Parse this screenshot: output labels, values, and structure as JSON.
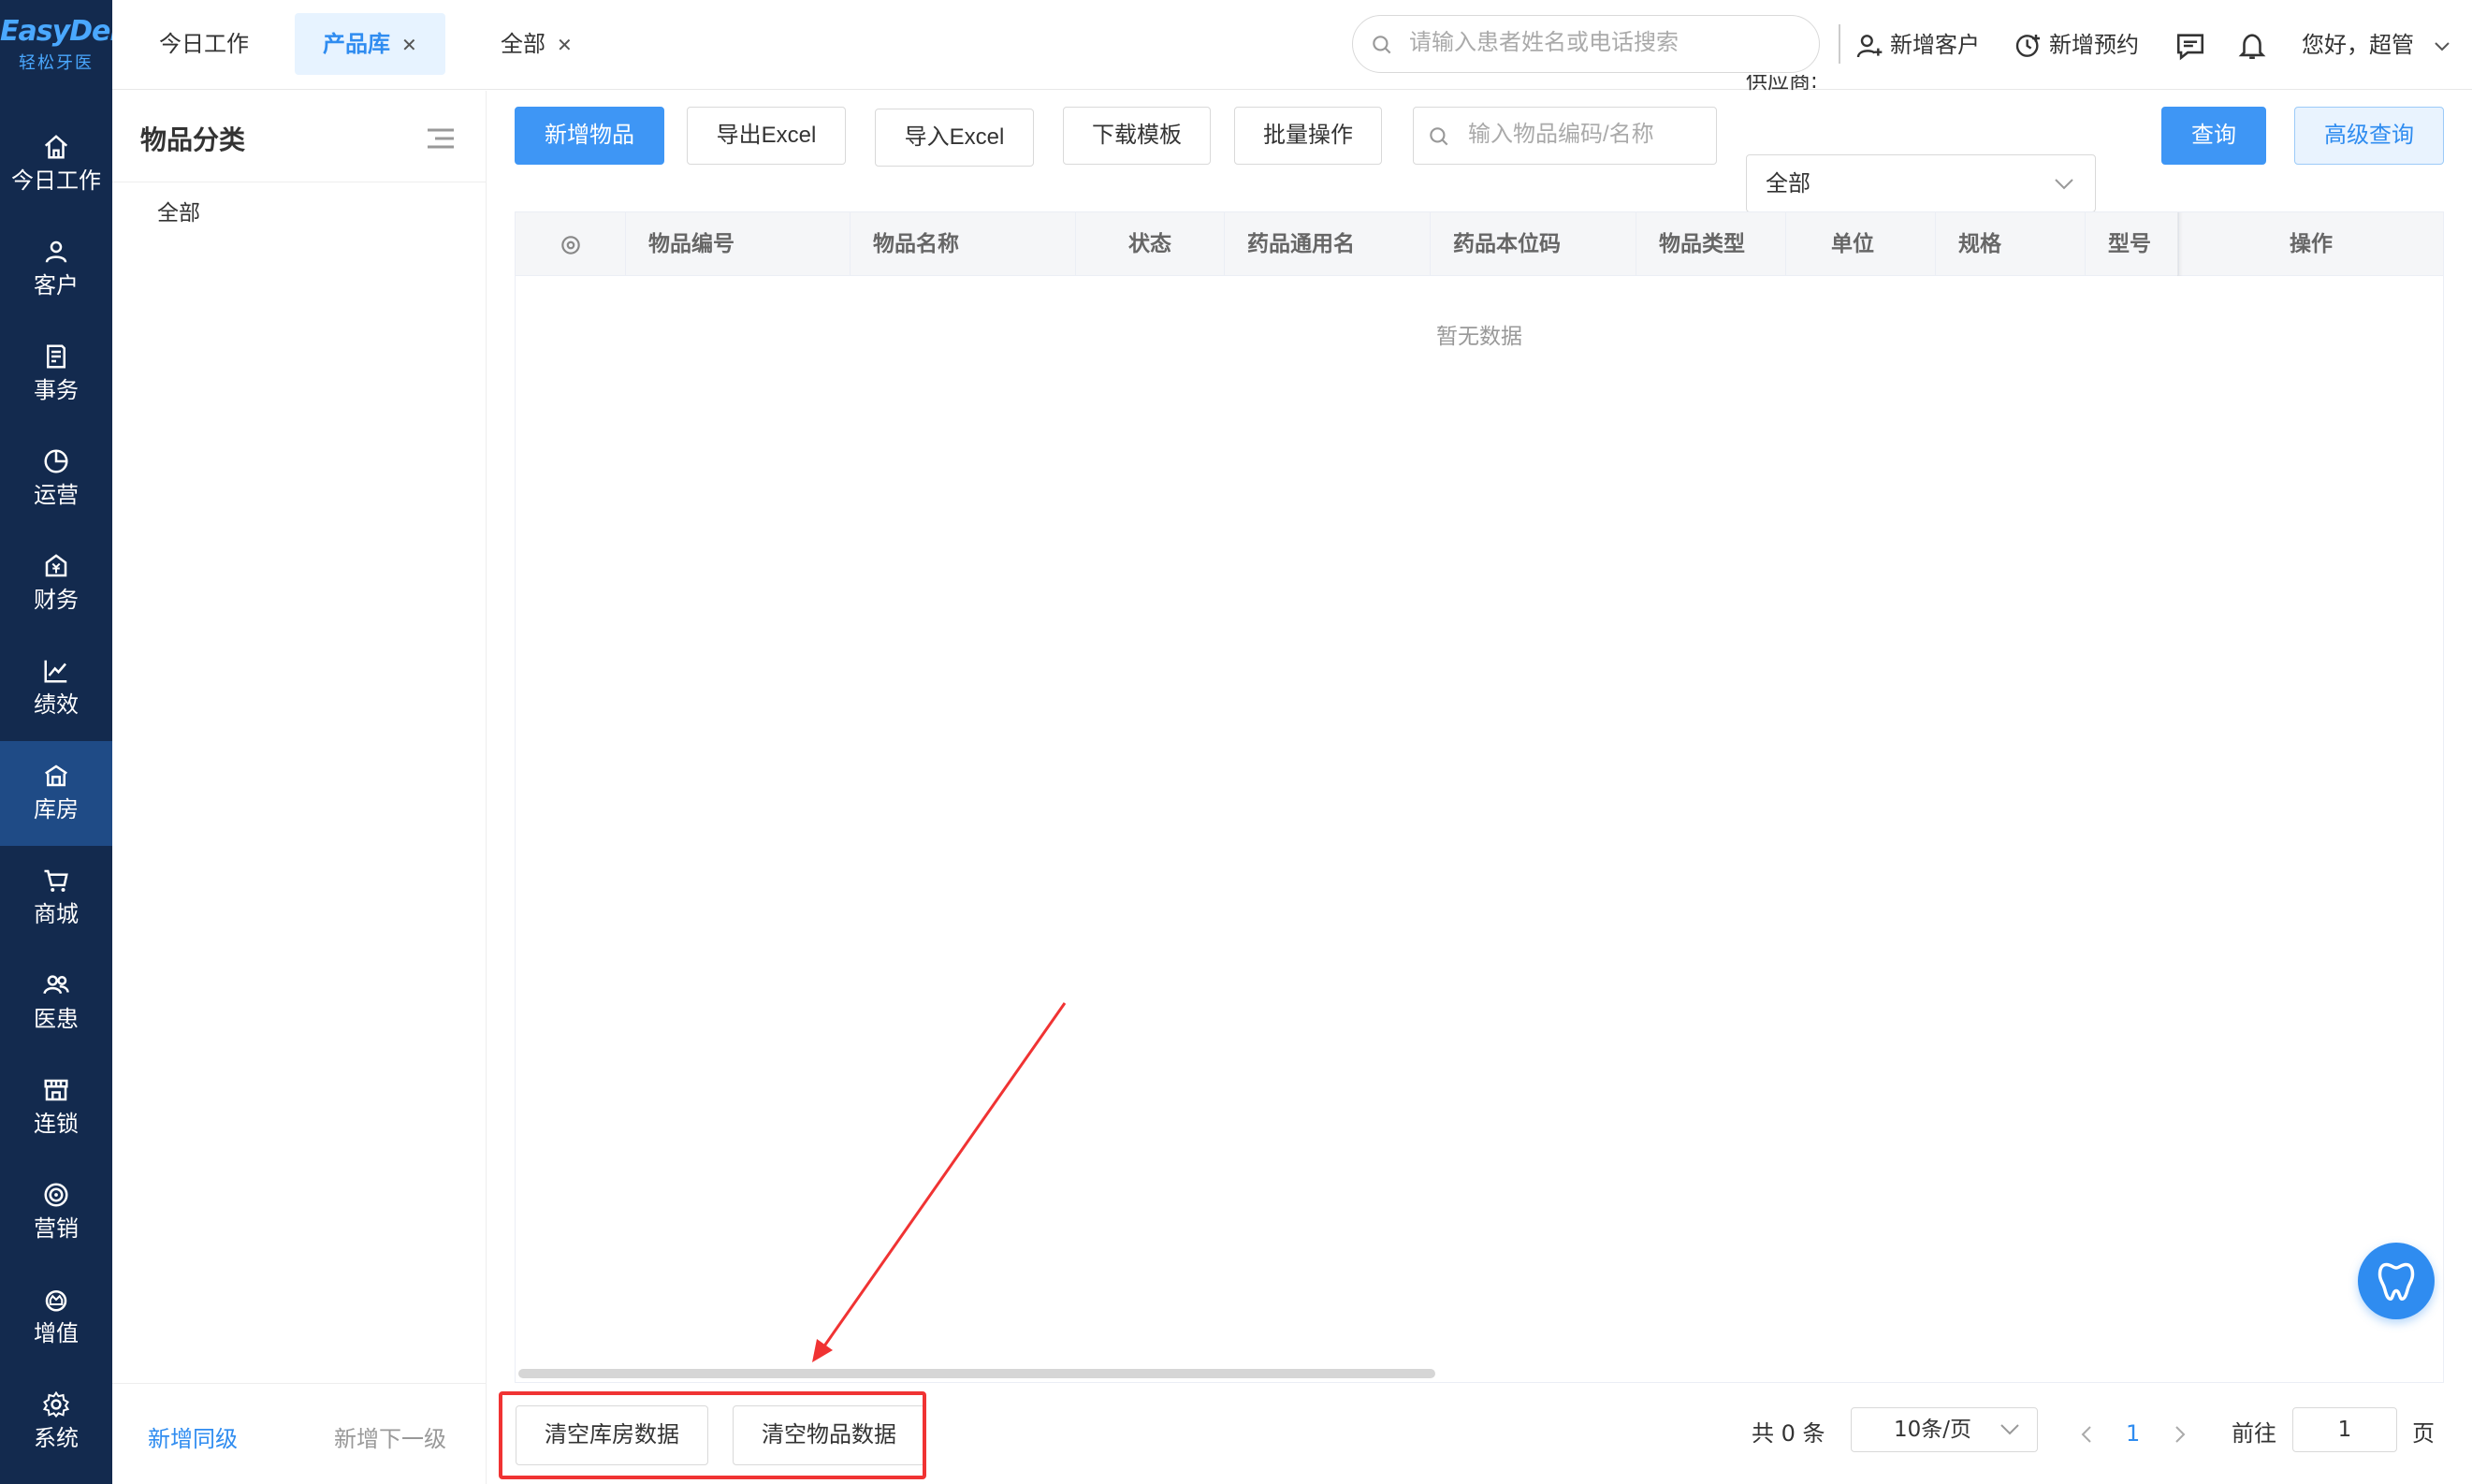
{
  "brand": {
    "logo_en": "EasyDent",
    "logo_cn": "轻松牙医",
    "accent": "#2f8cf0",
    "nav_bg": "#132a4e"
  },
  "nav": [
    {
      "label": "今日工作",
      "icon": "home-icon"
    },
    {
      "label": "客户",
      "icon": "user-icon"
    },
    {
      "label": "事务",
      "icon": "document-icon"
    },
    {
      "label": "运营",
      "icon": "pie-chart-icon"
    },
    {
      "label": "财务",
      "icon": "money-icon"
    },
    {
      "label": "绩效",
      "icon": "line-chart-icon"
    },
    {
      "label": "库房",
      "icon": "warehouse-icon",
      "active": true
    },
    {
      "label": "商城",
      "icon": "cart-icon"
    },
    {
      "label": "医患",
      "icon": "people-icon"
    },
    {
      "label": "连锁",
      "icon": "store-icon"
    },
    {
      "label": "营销",
      "icon": "target-icon"
    },
    {
      "label": "增值",
      "icon": "crown-icon"
    },
    {
      "label": "系统",
      "icon": "gear-icon"
    }
  ],
  "tabs": [
    {
      "label": "今日工作",
      "closable": false
    },
    {
      "label": "产品库",
      "closable": true,
      "active": true
    },
    {
      "label": "全部",
      "closable": true
    }
  ],
  "topbar": {
    "search_placeholder": "请输入患者姓名或电话搜索",
    "new_customer": "新增客户",
    "new_appointment": "新增预约",
    "greeting": "您好，超管"
  },
  "category": {
    "title": "物品分类",
    "items": [
      "全部"
    ],
    "add_sibling": "新增同级",
    "add_child": "新增下一级"
  },
  "toolbar": {
    "add_item": "新增物品",
    "export_excel": "导出Excel",
    "import_excel": "导入Excel",
    "download_template": "下载模板",
    "batch_ops": "批量操作",
    "item_search_placeholder": "输入物品编码/名称",
    "supplier_label": "供应商:",
    "supplier_value": "全部",
    "query": "查询",
    "advanced_query": "高级查询"
  },
  "table": {
    "columns": [
      "物品编号",
      "物品名称",
      "状态",
      "药品通用名",
      "药品本位码",
      "物品类型",
      "单位",
      "规格",
      "型号",
      "操作"
    ],
    "empty_text": "暂无数据"
  },
  "footer": {
    "clear_warehouse": "清空库房数据",
    "clear_items": "清空物品数据",
    "total": "共 0 条",
    "page_size": "10条/页",
    "current_page": "1",
    "goto_label": "前往",
    "goto_value": "1",
    "page_unit": "页"
  },
  "annotation": {
    "color": "#f03333"
  }
}
